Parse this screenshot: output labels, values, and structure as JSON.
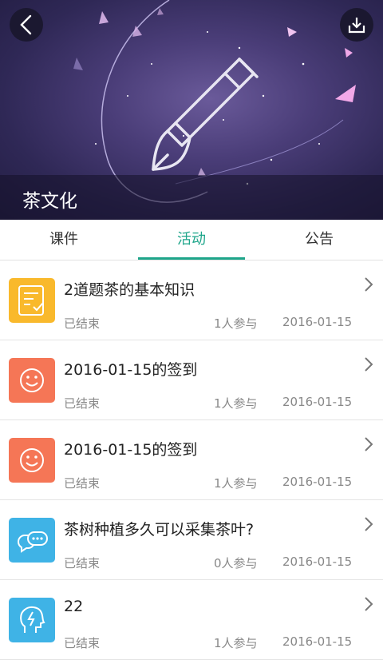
{
  "header": {
    "title": "茶文化",
    "back_icon": "back-arrow-icon",
    "download_icon": "download-icon",
    "banner_colors": [
      "#221d42",
      "#6a5a9a"
    ]
  },
  "tabs": [
    {
      "label": "课件",
      "active": false
    },
    {
      "label": "活动",
      "active": true
    },
    {
      "label": "公告",
      "active": false
    }
  ],
  "accent_color": "#1ea58a",
  "activities": [
    {
      "title": "2道题茶的基本知识",
      "status": "已结束",
      "participants": "1人参与",
      "date": "2016-01-15",
      "icon": "quiz-icon",
      "icon_color": "#f9b92c"
    },
    {
      "title": "2016-01-15的签到",
      "status": "已结束",
      "participants": "1人参与",
      "date": "2016-01-15",
      "icon": "smiley-icon",
      "icon_color": "#f57656"
    },
    {
      "title": "2016-01-15的签到",
      "status": "已结束",
      "participants": "1人参与",
      "date": "2016-01-15",
      "icon": "smiley-icon",
      "icon_color": "#f57656"
    },
    {
      "title": "茶树种植多久可以采集茶叶?",
      "status": "已结束",
      "participants": "0人参与",
      "date": "2016-01-15",
      "icon": "discussion-icon",
      "icon_color": "#3fb3e6"
    },
    {
      "title": "22",
      "status": "已结束",
      "participants": "1人参与",
      "date": "2016-01-15",
      "icon": "brainstorm-icon",
      "icon_color": "#3fb3e6"
    }
  ]
}
